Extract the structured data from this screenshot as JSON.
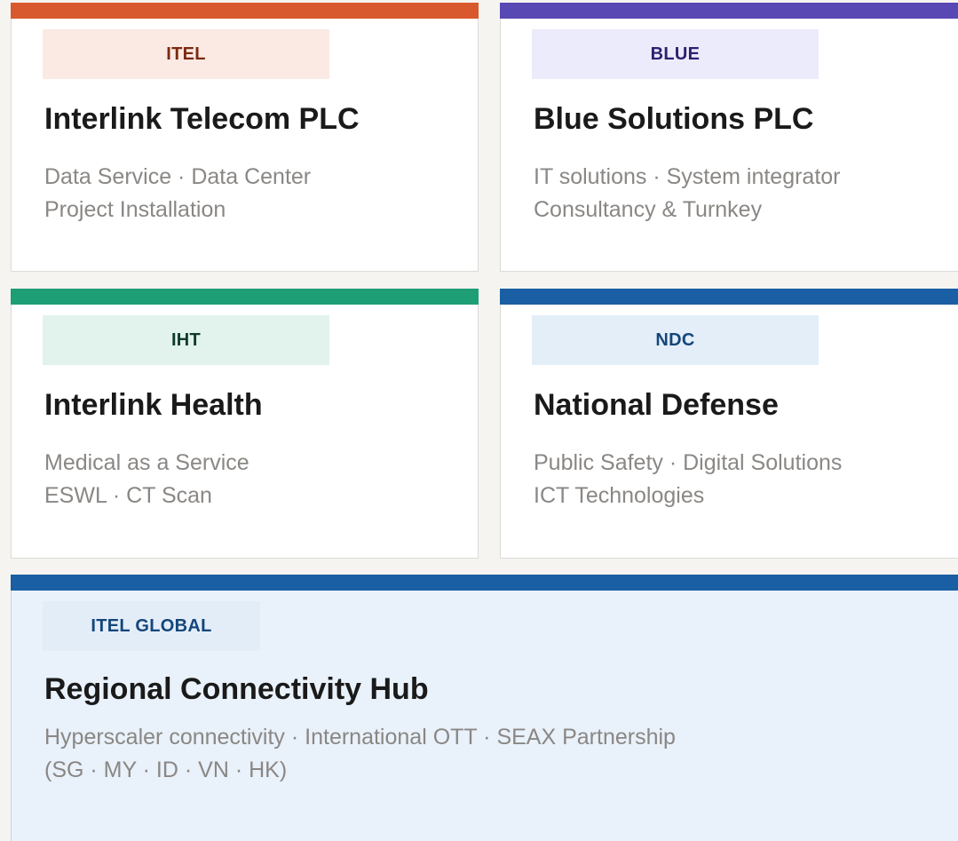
{
  "colors": {
    "itel_accent": "#d9592e",
    "blue_accent": "#5848b4",
    "iht_accent": "#1e9e74",
    "ndc_accent": "#1a5fa3",
    "global_accent": "#1a5fa3"
  },
  "cards": [
    {
      "badge": "ITEL",
      "title": "Interlink Telecom PLC",
      "lines": [
        "Data Service · Data Center",
        "Project Installation"
      ]
    },
    {
      "badge": "BLUE",
      "title": "Blue Solutions PLC",
      "lines": [
        "IT solutions · System integrator",
        "Consultancy & Turnkey"
      ]
    },
    {
      "badge": "IHT",
      "title": "Interlink Health",
      "lines": [
        "Medical as a Service",
        "ESWL · CT Scan"
      ]
    },
    {
      "badge": "NDC",
      "title": "National Defense",
      "lines": [
        "Public Safety · Digital Solutions",
        "ICT Technologies"
      ]
    }
  ],
  "global_card": {
    "badge": "ITEL GLOBAL",
    "title": "Regional Connectivity Hub",
    "lines": [
      "Hyperscaler connectivity · International OTT · SEAX Partnership",
      "(SG · MY · ID · VN · HK)"
    ]
  }
}
